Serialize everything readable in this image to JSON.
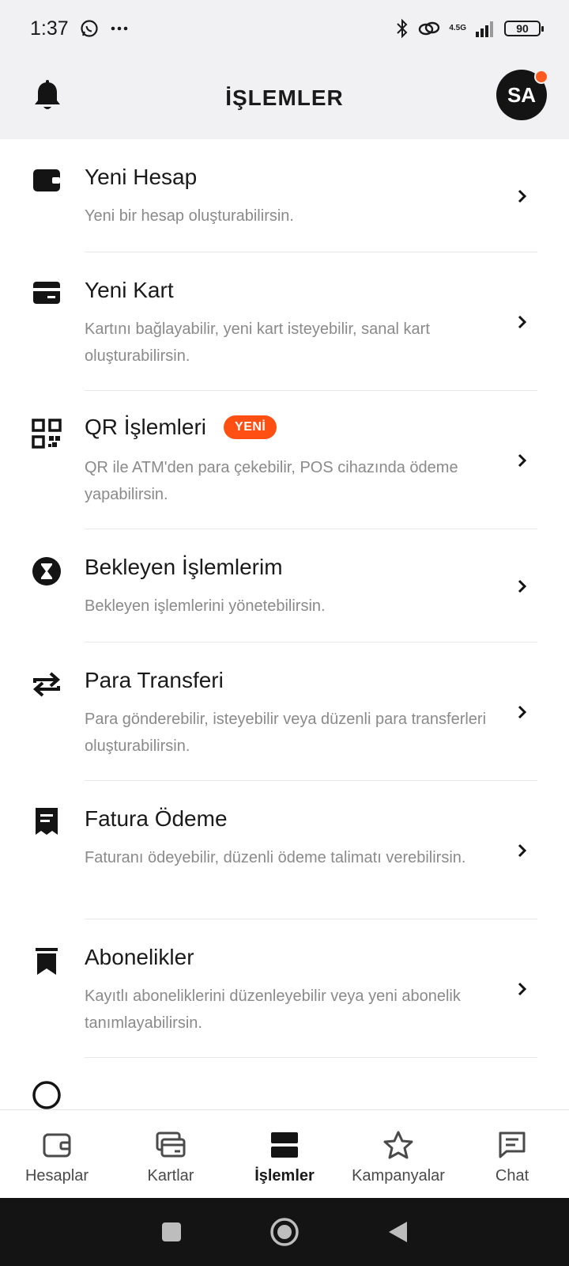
{
  "status_bar": {
    "time": "1:37",
    "network": "4.5G",
    "battery": "90"
  },
  "header": {
    "title": "İŞLEMLER",
    "avatar_initials": "SA"
  },
  "items": [
    {
      "title": "Yeni Hesap",
      "desc": "Yeni bir hesap oluşturabilirsin.",
      "icon": "wallet-icon"
    },
    {
      "title": "Yeni Kart",
      "desc": "Kartını bağlayabilir, yeni kart isteyebilir, sanal kart oluşturabilirsin.",
      "icon": "card-icon"
    },
    {
      "title": "QR İşlemleri",
      "badge": "YENİ",
      "desc": "QR ile ATM'den para çekebilir, POS cihazında ödeme yapabilirsin.",
      "icon": "qr-icon"
    },
    {
      "title": "Bekleyen İşlemlerim",
      "desc": "Bekleyen işlemlerini yönetebilirsin.",
      "icon": "hourglass-icon"
    },
    {
      "title": "Para Transferi",
      "desc": "Para gönderebilir, isteyebilir veya düzenli para transferleri oluşturabilirsin.",
      "icon": "transfer-icon"
    },
    {
      "title": "Fatura Ödeme",
      "desc": "Faturanı ödeyebilir, düzenli ödeme talimatı verebilirsin.",
      "icon": "receipt-icon"
    },
    {
      "title": "Abonelikler",
      "desc": "Kayıtlı aboneliklerini düzenleyebilir veya yeni abonelik tanımlayabilirsin.",
      "icon": "bookmark-icon"
    }
  ],
  "bottom_nav": [
    {
      "label": "Hesaplar",
      "icon": "wallet-icon"
    },
    {
      "label": "Kartlar",
      "icon": "cards-icon"
    },
    {
      "label": "İşlemler",
      "icon": "transactions-icon",
      "active": true
    },
    {
      "label": "Kampanyalar",
      "icon": "star-icon"
    },
    {
      "label": "Chat",
      "icon": "chat-icon"
    }
  ],
  "colors": {
    "accent": "#ff4f12",
    "header_bg": "#f1f1f3",
    "text": "#1a1a1a",
    "muted": "#8a8a8a"
  }
}
